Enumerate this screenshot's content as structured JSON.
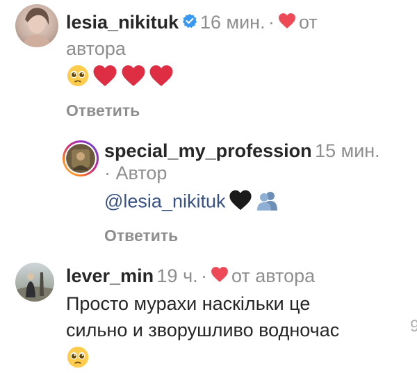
{
  "comments": [
    {
      "username": "lesia_nikituk",
      "time": "16 мин.",
      "separator": "·",
      "liked_label_1": "от",
      "liked_label_2": "автора",
      "reply_label": "Ответить",
      "emoji_icons": [
        "pleading-face-emoji",
        "red-heart-emoji",
        "red-heart-emoji",
        "red-heart-emoji"
      ]
    },
    {
      "username": "special_my_profession",
      "time": "15 мин.",
      "author_label": "· Автор",
      "mention": "@lesia_nikituk",
      "emoji_icons": [
        "black-heart-emoji",
        "busts-in-silhouette-emoji"
      ],
      "reply_label": "Ответить"
    },
    {
      "username": "lever_min",
      "time": "19 ч.",
      "separator": "·",
      "liked_label": "от автора",
      "text_line_1": "Просто мурахи наскільки це",
      "text_line_2": "сильно и зворушливо водночас",
      "emoji_icons": [
        "pleading-face-emoji"
      ]
    }
  ],
  "edge_glyph": "9",
  "colors": {
    "username": "#262626",
    "meta": "#8e8e8e",
    "mention": "#385185",
    "like_heart": "#ed4956",
    "verified": "#3897f0"
  }
}
